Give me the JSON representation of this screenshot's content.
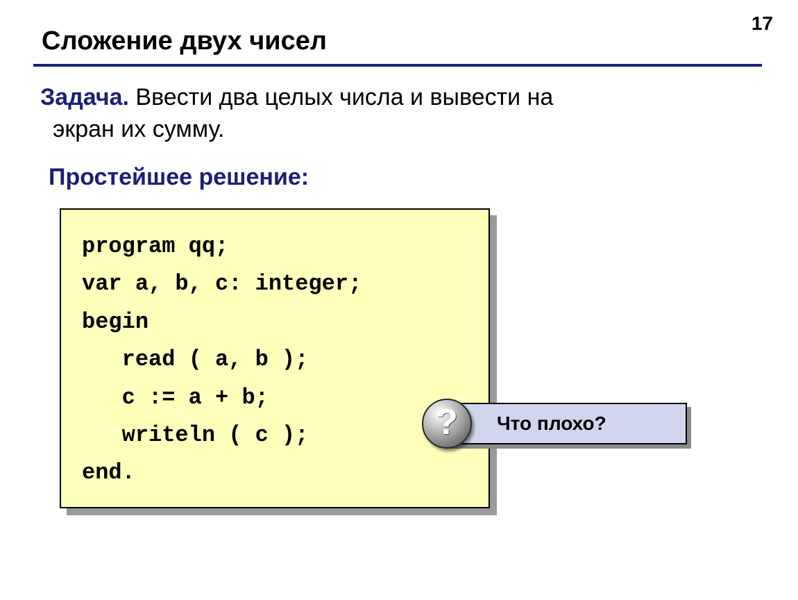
{
  "page_number": "17",
  "title": "Сложение двух чисел",
  "task": {
    "label": "Задача.",
    "text_line1": " Ввести два целых числа и вывести на",
    "text_line2": "экран их сумму."
  },
  "solution_label": "Простейшее решение:",
  "code": "program qq;\nvar a, b, c: integer;\nbegin\n   read ( a, b );\n   c := a + b;\n   writeln ( c );\nend.",
  "callout": {
    "icon_char": "?",
    "text": "Что плохо?"
  }
}
